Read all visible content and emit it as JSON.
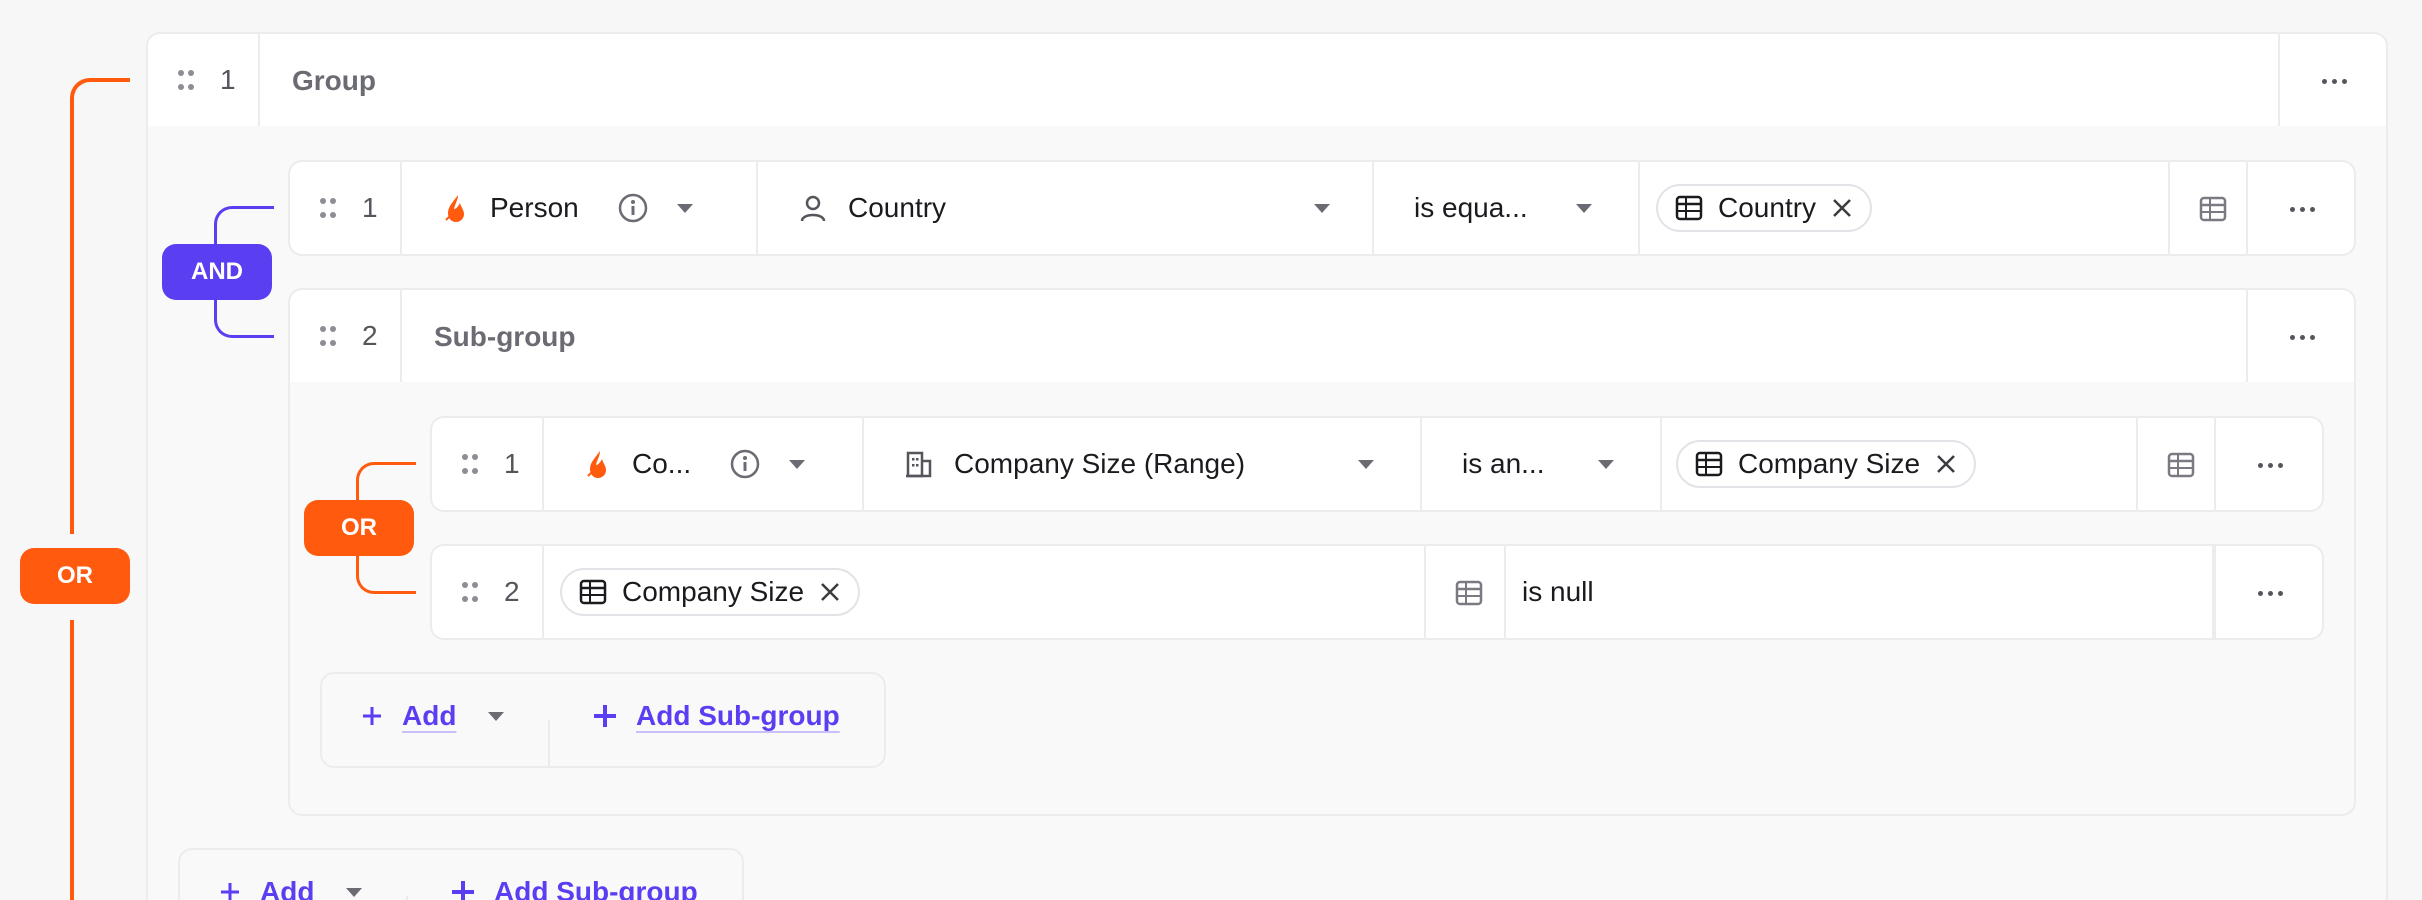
{
  "colors": {
    "or_accent": "#ff5a0e",
    "and_accent": "#5a3ef2"
  },
  "root": {
    "connector": "OR",
    "group": {
      "index": "1",
      "title": "Group",
      "connector": "AND",
      "conditions": [
        {
          "index": "1",
          "source_icon": "flame-icon",
          "source": "Person",
          "field_icon": "person-icon",
          "field": "Country",
          "operator": "is equa...",
          "value_chip": "Country"
        }
      ],
      "subgroup": {
        "index": "2",
        "title": "Sub-group",
        "connector": "OR",
        "conditions": [
          {
            "index": "1",
            "source_icon": "flame-icon",
            "source": "Co...",
            "field_icon": "building-icon",
            "field": "Company Size (Range)",
            "operator": "is an...",
            "value_chip": "Company Size"
          },
          {
            "index": "2",
            "left_chip": "Company Size",
            "operator": "is null"
          }
        ],
        "add_label": "Add",
        "add_subgroup_label": "Add Sub-group"
      },
      "add_label": "Add",
      "add_subgroup_label": "Add Sub-group"
    }
  }
}
